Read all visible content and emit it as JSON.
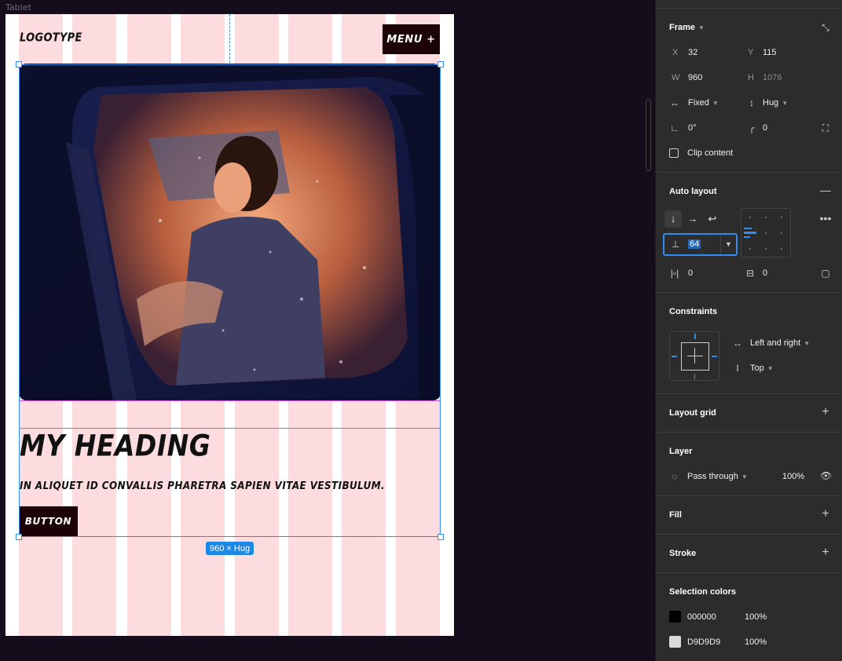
{
  "canvas": {
    "frame_label": "Tablet",
    "logo": "LOGOTYPE",
    "menu_button": "MENU +",
    "heading": "MY HEADING",
    "paragraph": "IN ALIQUET ID CONVALLIS PHARETRA SAPIEN VITAE VESTIBULUM.",
    "button": "BUTTON",
    "size_badge": "960 × Hug"
  },
  "panel": {
    "frame": {
      "title": "Frame",
      "x_label": "X",
      "x": "32",
      "y_label": "Y",
      "y": "115",
      "w_label": "W",
      "w": "960",
      "h_label": "H",
      "h": "1076",
      "width_mode": "Fixed",
      "height_mode": "Hug",
      "rotation": "0°",
      "radius": "0",
      "clip_content": "Clip content"
    },
    "auto_layout": {
      "title": "Auto layout",
      "gap": "64",
      "padding_h": "0",
      "padding_v": "0"
    },
    "constraints": {
      "title": "Constraints",
      "horizontal": "Left and right",
      "vertical": "Top"
    },
    "layout_grid": {
      "title": "Layout grid"
    },
    "layer": {
      "title": "Layer",
      "blend": "Pass through",
      "opacity": "100%"
    },
    "fill": {
      "title": "Fill"
    },
    "stroke": {
      "title": "Stroke"
    },
    "selection_colors": {
      "title": "Selection colors",
      "colors": [
        {
          "hex": "000000",
          "opacity": "100%",
          "swatch": "#000000"
        },
        {
          "hex": "D9D9D9",
          "opacity": "100%",
          "swatch": "#D9D9D9"
        }
      ]
    }
  },
  "colors": {
    "canvas_bg": "#150d1c",
    "grid_column": "#fddcdf",
    "selection": "#2f8cf0",
    "spacer_outline": "#d64fd6",
    "button_bg": "#1b0307",
    "panel_bg": "#2c2c2c"
  }
}
